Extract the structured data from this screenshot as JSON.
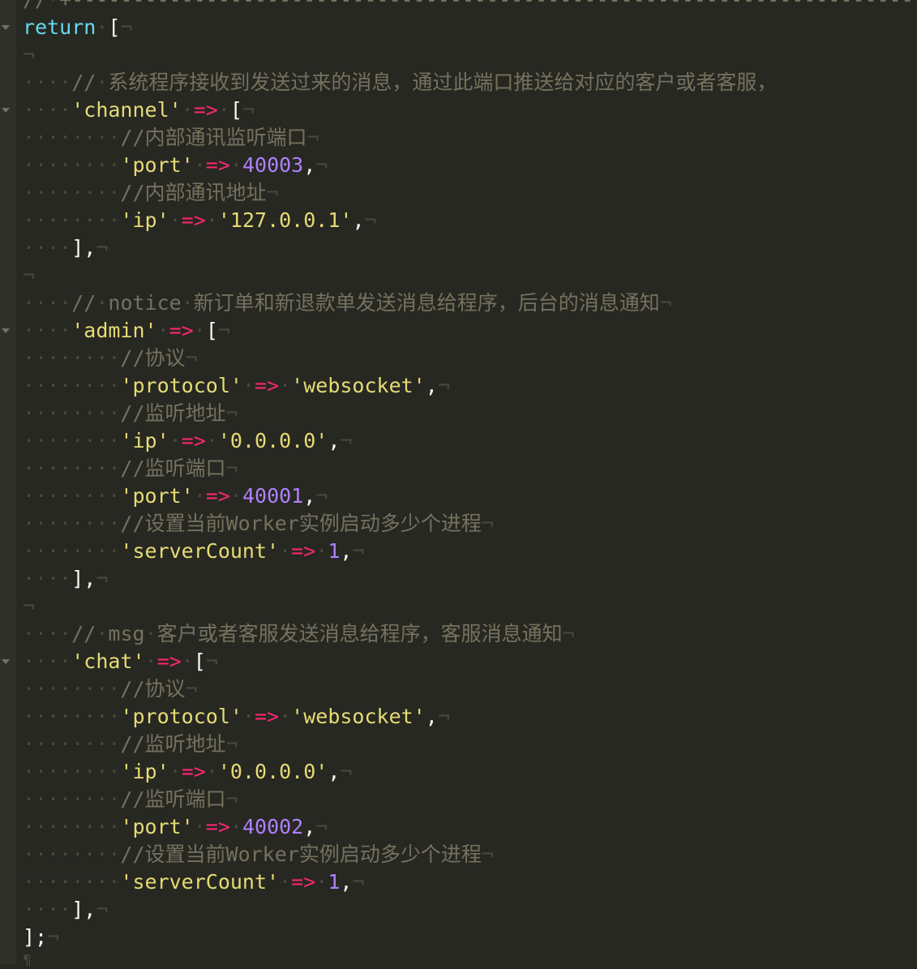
{
  "editor": {
    "colors": {
      "background": "#272822",
      "gutter": "#2f3129",
      "keyword": "#66d9ef",
      "string": "#e6db74",
      "operator": "#f92672",
      "number": "#ae81ff",
      "comment": "#75715e",
      "invisible": "#49483e",
      "text": "#f8f8f2"
    },
    "lines": [
      {
        "fold": false,
        "tokens": [
          [
            "cm",
            "//"
          ],
          [
            "ws",
            "·"
          ],
          [
            "cm",
            "+"
          ],
          [
            "dash",
            "------------------------------------------------------------------------"
          ]
        ]
      },
      {
        "fold": true,
        "tokens": [
          [
            "kw",
            "return"
          ],
          [
            "ws",
            "·"
          ],
          [
            "pn",
            "["
          ],
          [
            "ws",
            "¬"
          ]
        ]
      },
      {
        "fold": false,
        "tokens": [
          [
            "ws",
            "¬"
          ]
        ]
      },
      {
        "fold": false,
        "tokens": [
          [
            "ws",
            "····"
          ],
          [
            "cm",
            "//"
          ],
          [
            "ws",
            "·"
          ],
          [
            "cm",
            "系统程序接收到发送过来的消息，通过此端口推送给对应的客户或者客服，"
          ]
        ]
      },
      {
        "fold": true,
        "tokens": [
          [
            "ws",
            "····"
          ],
          [
            "str",
            "'channel'"
          ],
          [
            "ws",
            "·"
          ],
          [
            "op",
            "=>"
          ],
          [
            "ws",
            "·"
          ],
          [
            "pn",
            "["
          ],
          [
            "ws",
            "¬"
          ]
        ]
      },
      {
        "fold": false,
        "tokens": [
          [
            "ws",
            "········"
          ],
          [
            "cm",
            "//内部通讯监听端口"
          ],
          [
            "ws",
            "¬"
          ]
        ]
      },
      {
        "fold": false,
        "tokens": [
          [
            "ws",
            "········"
          ],
          [
            "str",
            "'port'"
          ],
          [
            "ws",
            "·"
          ],
          [
            "op",
            "=>"
          ],
          [
            "ws",
            "·"
          ],
          [
            "num",
            "40003"
          ],
          [
            "pn",
            ","
          ],
          [
            "ws",
            "¬"
          ]
        ]
      },
      {
        "fold": false,
        "tokens": [
          [
            "ws",
            "········"
          ],
          [
            "cm",
            "//内部通讯地址"
          ],
          [
            "ws",
            "¬"
          ]
        ]
      },
      {
        "fold": false,
        "tokens": [
          [
            "ws",
            "········"
          ],
          [
            "str",
            "'ip'"
          ],
          [
            "ws",
            "·"
          ],
          [
            "op",
            "=>"
          ],
          [
            "ws",
            "·"
          ],
          [
            "str",
            "'127.0.0.1'"
          ],
          [
            "pn",
            ","
          ],
          [
            "ws",
            "¬"
          ]
        ]
      },
      {
        "fold": false,
        "tokens": [
          [
            "ws",
            "····"
          ],
          [
            "pn",
            "],"
          ],
          [
            "ws",
            "¬"
          ]
        ]
      },
      {
        "fold": false,
        "tokens": [
          [
            "ws",
            "¬"
          ]
        ]
      },
      {
        "fold": false,
        "tokens": [
          [
            "ws",
            "····"
          ],
          [
            "cm",
            "//"
          ],
          [
            "ws",
            "·"
          ],
          [
            "cm",
            "notice"
          ],
          [
            "ws",
            "·"
          ],
          [
            "cm",
            "新订单和新退款单发送消息给程序，后台的消息通知"
          ],
          [
            "ws",
            "¬"
          ]
        ]
      },
      {
        "fold": true,
        "tokens": [
          [
            "ws",
            "····"
          ],
          [
            "str",
            "'admin'"
          ],
          [
            "ws",
            "·"
          ],
          [
            "op",
            "=>"
          ],
          [
            "ws",
            "·"
          ],
          [
            "pn",
            "["
          ],
          [
            "ws",
            "¬"
          ]
        ]
      },
      {
        "fold": false,
        "tokens": [
          [
            "ws",
            "········"
          ],
          [
            "cm",
            "//协议"
          ],
          [
            "ws",
            "¬"
          ]
        ]
      },
      {
        "fold": false,
        "tokens": [
          [
            "ws",
            "········"
          ],
          [
            "str",
            "'protocol'"
          ],
          [
            "ws",
            "·"
          ],
          [
            "op",
            "=>"
          ],
          [
            "ws",
            "·"
          ],
          [
            "str",
            "'websocket'"
          ],
          [
            "pn",
            ","
          ],
          [
            "ws",
            "¬"
          ]
        ]
      },
      {
        "fold": false,
        "tokens": [
          [
            "ws",
            "········"
          ],
          [
            "cm",
            "//监听地址"
          ],
          [
            "ws",
            "¬"
          ]
        ]
      },
      {
        "fold": false,
        "tokens": [
          [
            "ws",
            "········"
          ],
          [
            "str",
            "'ip'"
          ],
          [
            "ws",
            "·"
          ],
          [
            "op",
            "=>"
          ],
          [
            "ws",
            "·"
          ],
          [
            "str",
            "'0.0.0.0'"
          ],
          [
            "pn",
            ","
          ],
          [
            "ws",
            "¬"
          ]
        ]
      },
      {
        "fold": false,
        "tokens": [
          [
            "ws",
            "········"
          ],
          [
            "cm",
            "//监听端口"
          ],
          [
            "ws",
            "¬"
          ]
        ]
      },
      {
        "fold": false,
        "tokens": [
          [
            "ws",
            "········"
          ],
          [
            "str",
            "'port'"
          ],
          [
            "ws",
            "·"
          ],
          [
            "op",
            "=>"
          ],
          [
            "ws",
            "·"
          ],
          [
            "num",
            "40001"
          ],
          [
            "pn",
            ","
          ],
          [
            "ws",
            "¬"
          ]
        ]
      },
      {
        "fold": false,
        "tokens": [
          [
            "ws",
            "········"
          ],
          [
            "cm",
            "//设置当前Worker实例启动多少个进程"
          ],
          [
            "ws",
            "¬"
          ]
        ]
      },
      {
        "fold": false,
        "tokens": [
          [
            "ws",
            "········"
          ],
          [
            "str",
            "'serverCount'"
          ],
          [
            "ws",
            "·"
          ],
          [
            "op",
            "=>"
          ],
          [
            "ws",
            "·"
          ],
          [
            "num",
            "1"
          ],
          [
            "pn",
            ","
          ],
          [
            "ws",
            "¬"
          ]
        ]
      },
      {
        "fold": false,
        "tokens": [
          [
            "ws",
            "····"
          ],
          [
            "pn",
            "],"
          ],
          [
            "ws",
            "¬"
          ]
        ]
      },
      {
        "fold": false,
        "tokens": [
          [
            "ws",
            "¬"
          ]
        ]
      },
      {
        "fold": false,
        "tokens": [
          [
            "ws",
            "····"
          ],
          [
            "cm",
            "//"
          ],
          [
            "ws",
            "·"
          ],
          [
            "cm",
            "msg"
          ],
          [
            "ws",
            "·"
          ],
          [
            "cm",
            "客户或者客服发送消息给程序，客服消息通知"
          ],
          [
            "ws",
            "¬"
          ]
        ]
      },
      {
        "fold": true,
        "tokens": [
          [
            "ws",
            "····"
          ],
          [
            "str",
            "'chat'"
          ],
          [
            "ws",
            "·"
          ],
          [
            "op",
            "=>"
          ],
          [
            "ws",
            "·"
          ],
          [
            "pn",
            "["
          ],
          [
            "ws",
            "¬"
          ]
        ]
      },
      {
        "fold": false,
        "tokens": [
          [
            "ws",
            "········"
          ],
          [
            "cm",
            "//协议"
          ],
          [
            "ws",
            "¬"
          ]
        ]
      },
      {
        "fold": false,
        "tokens": [
          [
            "ws",
            "········"
          ],
          [
            "str",
            "'protocol'"
          ],
          [
            "ws",
            "·"
          ],
          [
            "op",
            "=>"
          ],
          [
            "ws",
            "·"
          ],
          [
            "str",
            "'websocket'"
          ],
          [
            "pn",
            ","
          ],
          [
            "ws",
            "¬"
          ]
        ]
      },
      {
        "fold": false,
        "tokens": [
          [
            "ws",
            "········"
          ],
          [
            "cm",
            "//监听地址"
          ],
          [
            "ws",
            "¬"
          ]
        ]
      },
      {
        "fold": false,
        "tokens": [
          [
            "ws",
            "········"
          ],
          [
            "str",
            "'ip'"
          ],
          [
            "ws",
            "·"
          ],
          [
            "op",
            "=>"
          ],
          [
            "ws",
            "·"
          ],
          [
            "str",
            "'0.0.0.0'"
          ],
          [
            "pn",
            ","
          ],
          [
            "ws",
            "¬"
          ]
        ]
      },
      {
        "fold": false,
        "tokens": [
          [
            "ws",
            "········"
          ],
          [
            "cm",
            "//监听端口"
          ],
          [
            "ws",
            "¬"
          ]
        ]
      },
      {
        "fold": false,
        "tokens": [
          [
            "ws",
            "········"
          ],
          [
            "str",
            "'port'"
          ],
          [
            "ws",
            "·"
          ],
          [
            "op",
            "=>"
          ],
          [
            "ws",
            "·"
          ],
          [
            "num",
            "40002"
          ],
          [
            "pn",
            ","
          ],
          [
            "ws",
            "¬"
          ]
        ]
      },
      {
        "fold": false,
        "tokens": [
          [
            "ws",
            "········"
          ],
          [
            "cm",
            "//设置当前Worker实例启动多少个进程"
          ],
          [
            "ws",
            "¬"
          ]
        ]
      },
      {
        "fold": false,
        "tokens": [
          [
            "ws",
            "········"
          ],
          [
            "str",
            "'serverCount'"
          ],
          [
            "ws",
            "·"
          ],
          [
            "op",
            "=>"
          ],
          [
            "ws",
            "·"
          ],
          [
            "num",
            "1"
          ],
          [
            "pn",
            ","
          ],
          [
            "ws",
            "¬"
          ]
        ]
      },
      {
        "fold": false,
        "tokens": [
          [
            "ws",
            "····"
          ],
          [
            "pn",
            "],"
          ],
          [
            "ws",
            "¬"
          ]
        ]
      },
      {
        "fold": false,
        "tokens": [
          [
            "pn",
            "];"
          ],
          [
            "ws",
            "¬"
          ]
        ]
      }
    ],
    "eof_marker": "¶"
  }
}
